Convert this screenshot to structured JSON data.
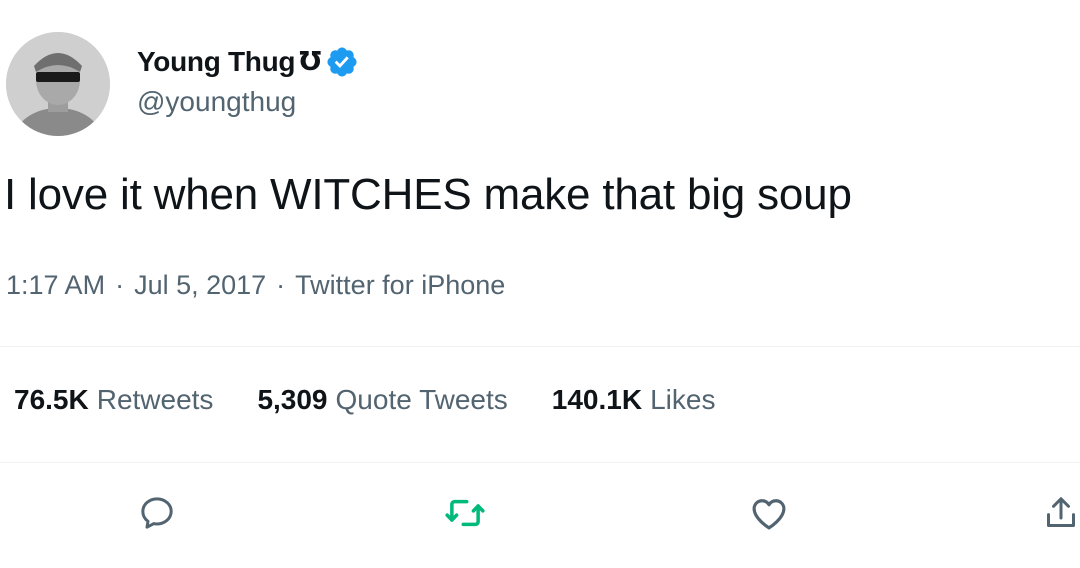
{
  "user": {
    "display_name": "Young Thug",
    "name_glyph": "Ʊ",
    "handle": "@youngthug",
    "verified": true,
    "verified_color": "#1d9bf0"
  },
  "tweet": {
    "text": "I love it when WITCHES make that big soup",
    "time": "1:17 AM",
    "date": "Jul 5, 2017",
    "source": "Twitter for iPhone",
    "separator": "·"
  },
  "stats": {
    "retweets": {
      "count": "76.5K",
      "label": "Retweets"
    },
    "quotes": {
      "count": "5,309",
      "label": "Quote Tweets"
    },
    "likes": {
      "count": "140.1K",
      "label": "Likes"
    }
  },
  "actions": {
    "reply_icon": "reply-icon",
    "retweet_icon": "retweet-icon",
    "like_icon": "heart-icon",
    "share_icon": "share-icon",
    "retweet_color": "#00ba7c"
  }
}
